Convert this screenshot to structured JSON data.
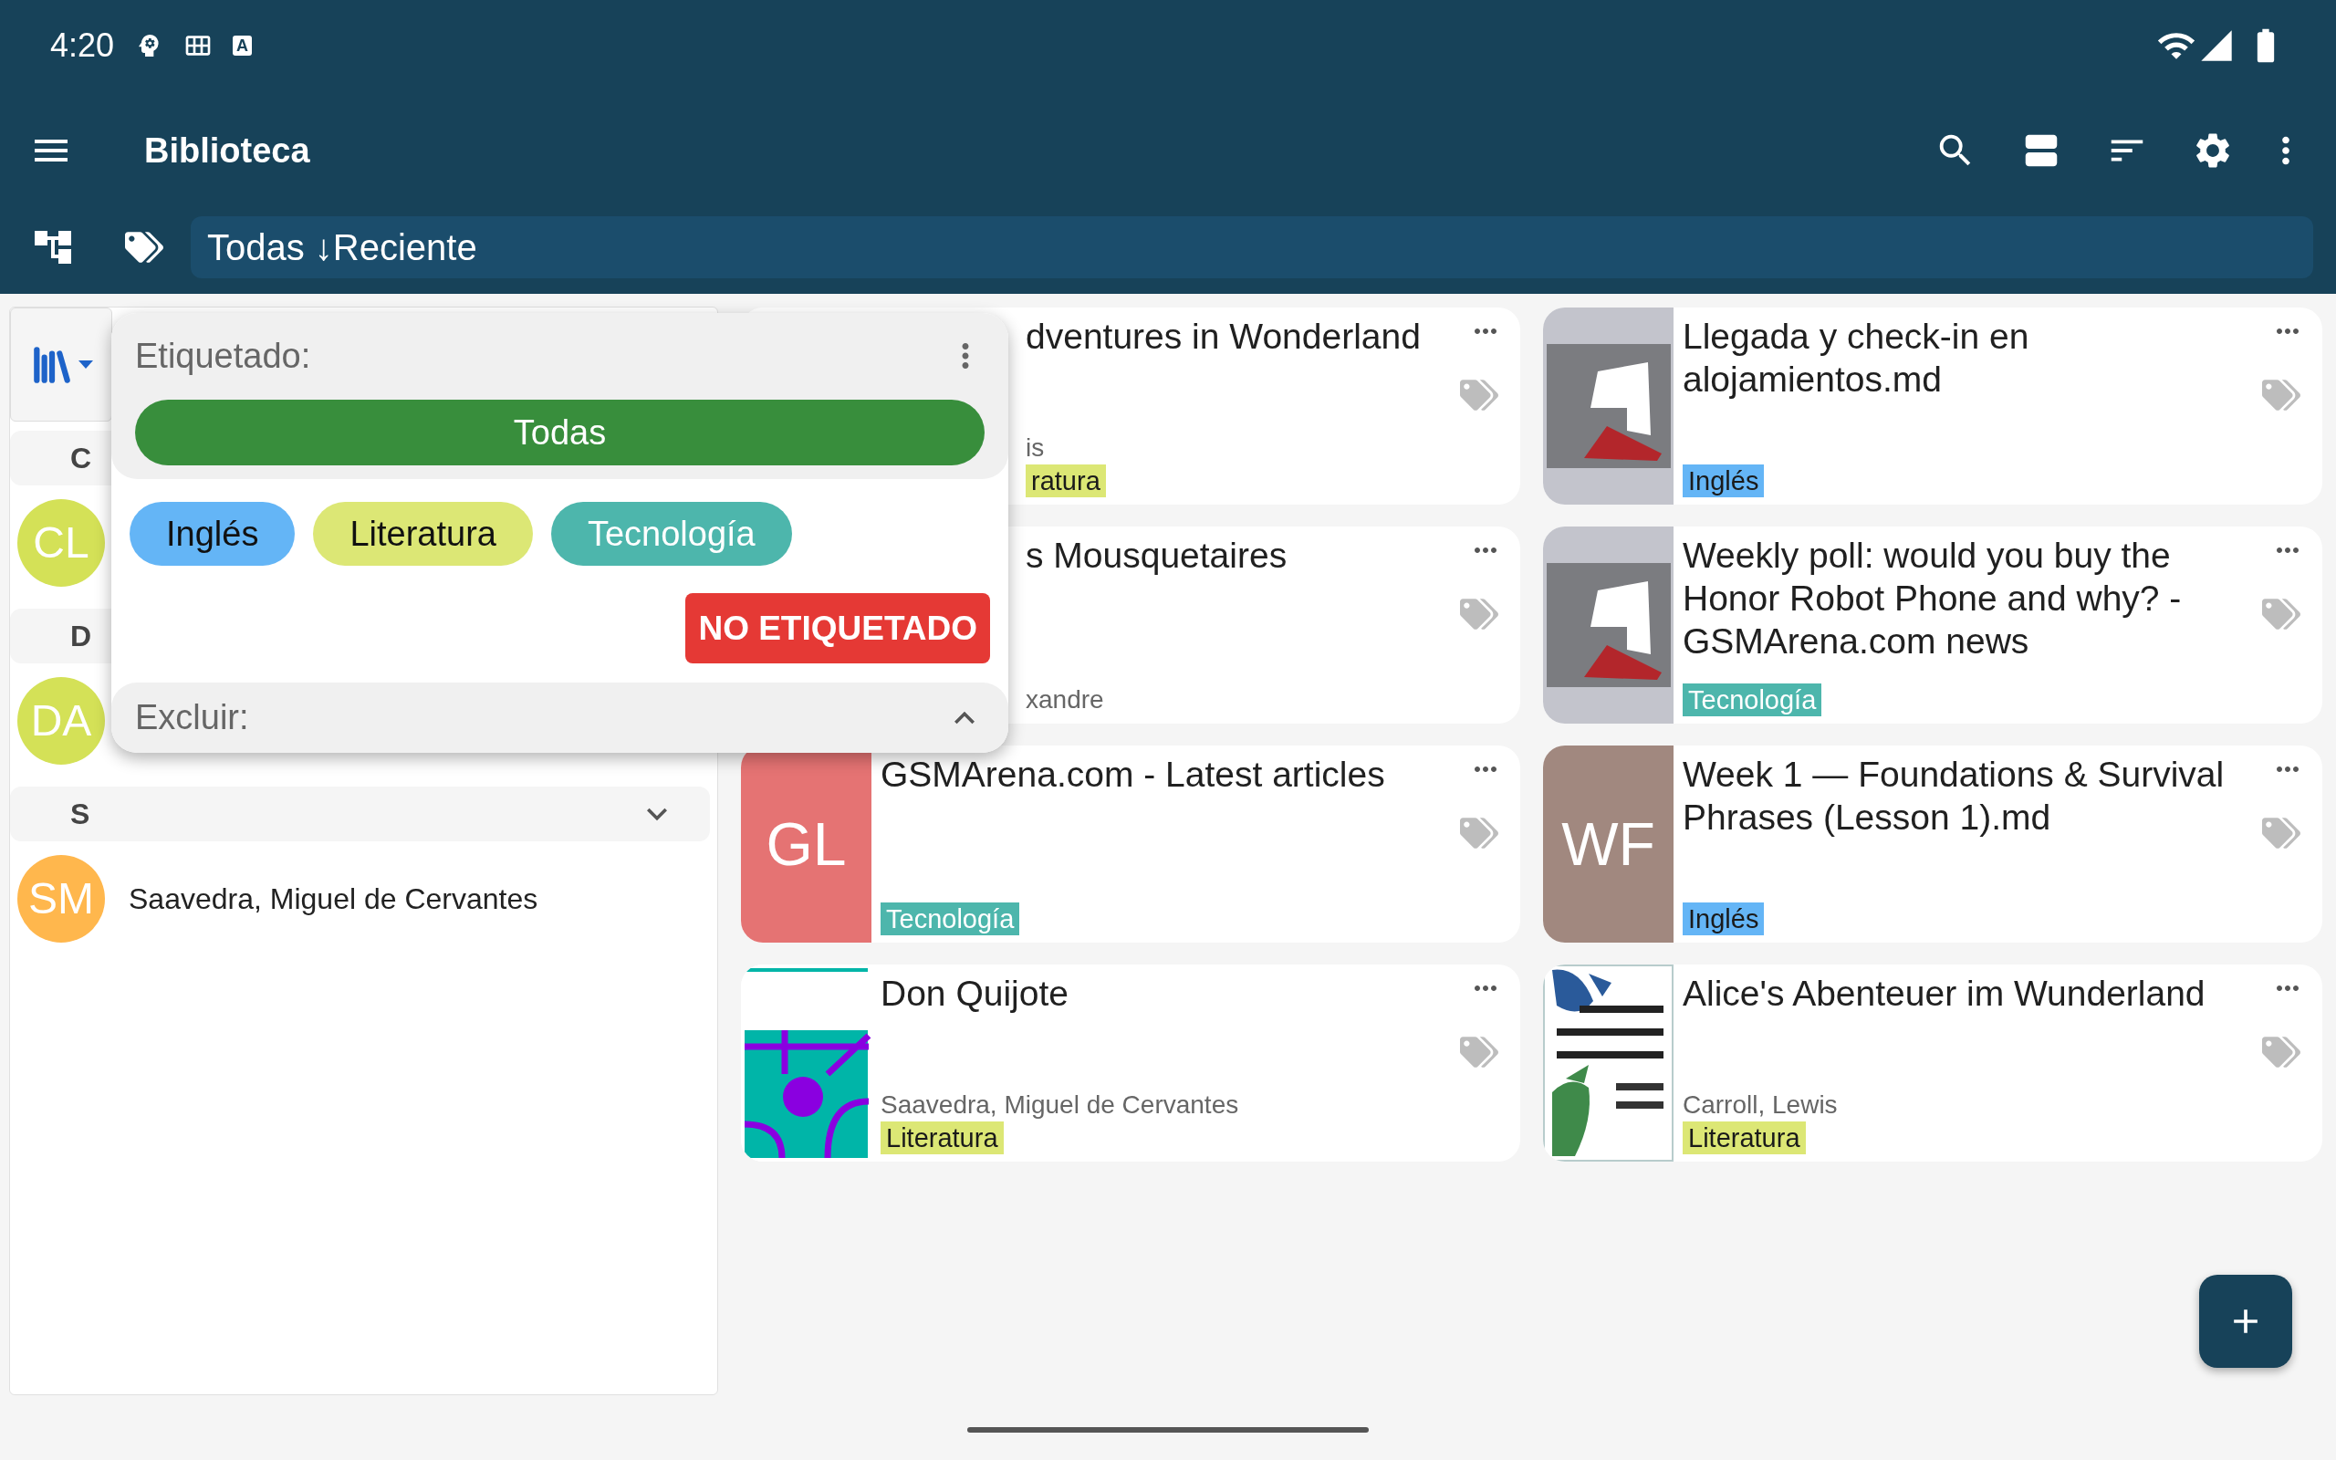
{
  "status_bar": {
    "time": "4:20",
    "badge": "A"
  },
  "toolbar": {
    "title": "Biblioteca"
  },
  "filter_bar": {
    "text": "Todas ↓Reciente"
  },
  "sidebar": {
    "sections": [
      {
        "letter": "C",
        "authors": [
          {
            "initials": "CL",
            "color": "#d4e157"
          }
        ]
      },
      {
        "letter": "D",
        "authors": [
          {
            "initials": "DA",
            "color": "#d4e157"
          }
        ]
      },
      {
        "letter": "S",
        "chevron": true,
        "authors": [
          {
            "initials": "SM",
            "name": "Saavedra, Miguel de Cervantes",
            "color": "#ffb74d"
          }
        ]
      }
    ]
  },
  "tag_popup": {
    "title": "Etiquetado:",
    "all_button": {
      "label": "Todas",
      "selected": true
    },
    "tags": [
      {
        "label": "Inglés",
        "color": "#64b5f6"
      },
      {
        "label": "Literatura",
        "color": "#dce775"
      },
      {
        "label": "Tecnología",
        "color": "#4db6ac"
      }
    ],
    "untagged_button": "NO ETIQUETADO",
    "exclude_label": "Excluir:"
  },
  "books": [
    {
      "kind": "covered",
      "title": "dventures in Wonderland",
      "author": "is",
      "tag": {
        "label": "ratura",
        "color": "#dce775"
      }
    },
    {
      "kind": "logo",
      "title": "Llegada y check-in en alojamientos.md",
      "tag": {
        "label": "Inglés",
        "color": "#64b5f6"
      }
    },
    {
      "kind": "covered",
      "title": "s Mousquetaires",
      "author": "xandre"
    },
    {
      "kind": "logo",
      "title": "Weekly poll: would you buy the Honor Robot Phone and why? - GSMArena.com news",
      "tag": {
        "label": "Tecnología",
        "color": "#4db6ac"
      }
    },
    {
      "kind": "initials",
      "initials": "GL",
      "color": "#e57373",
      "title": "GSMArena.com - Latest articles",
      "tag": {
        "label": "Tecnología",
        "color": "#4db6ac"
      }
    },
    {
      "kind": "initials",
      "initials": "WF",
      "color": "#a1887f",
      "title": "Week 1 — Foundations & Survival Phrases (Lesson 1).md",
      "tag": {
        "label": "Inglés",
        "color": "#64b5f6"
      }
    },
    {
      "kind": "quijote",
      "title": "Don Quijote",
      "author": "Saavedra, Miguel de Cervantes",
      "tag": {
        "label": "Literatura",
        "color": "#dce775"
      }
    },
    {
      "kind": "alice",
      "title": "Alice's Abenteuer im Wunderland",
      "author": "Carroll, Lewis",
      "tag": {
        "label": "Literatura",
        "color": "#dce775"
      }
    }
  ]
}
